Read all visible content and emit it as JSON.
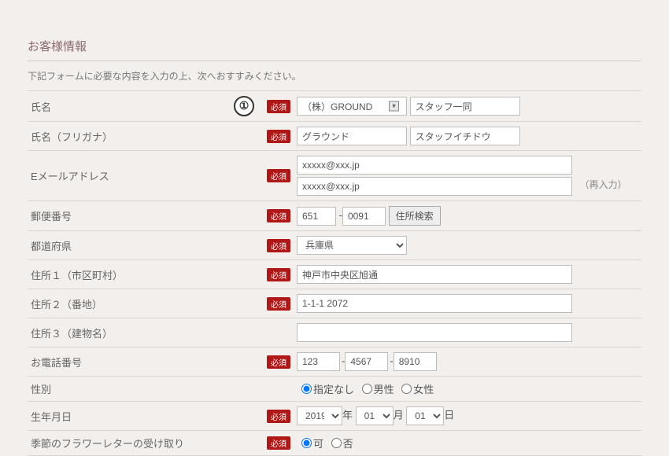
{
  "section_title": "お客様情報",
  "instruction": "下記フォームに必要な内容を入力の上、次へおすすみください。",
  "required_label": "必須",
  "fields": {
    "name": {
      "label": "氏名",
      "value1": "（株）GROUND",
      "value2": "スタッフ一同",
      "numbered": "①"
    },
    "furigana": {
      "label": "氏名（フリガナ）",
      "value1": "グラウンド",
      "value2": "スタッフイチドウ"
    },
    "email": {
      "label": "Eメールアドレス",
      "value1": "xxxxx@xxx.jp",
      "value2": "xxxxx@xxx.jp",
      "re_label": "（再入力）"
    },
    "postal": {
      "label": "郵便番号",
      "value1": "651",
      "value2": "0091",
      "search_btn": "住所検索"
    },
    "pref": {
      "label": "都道府県",
      "value": "兵庫県"
    },
    "addr1": {
      "label": "住所１（市区町村）",
      "value": "神戸市中央区旭通"
    },
    "addr2": {
      "label": "住所２（番地）",
      "value": "1-1-1 2072"
    },
    "addr3": {
      "label": "住所３（建物名）",
      "value": ""
    },
    "tel": {
      "label": "お電話番号",
      "v1": "123",
      "v2": "4567",
      "v3": "8910"
    },
    "gender": {
      "label": "性別",
      "opt_none": "指定なし",
      "opt_m": "男性",
      "opt_f": "女性"
    },
    "birth": {
      "label": "生年月日",
      "year": "2019",
      "month": "01",
      "day": "01",
      "y_l": "年",
      "m_l": "月",
      "d_l": "日"
    },
    "flower": {
      "label": "季節のフラワーレターの受け取り",
      "yes": "可",
      "no": "否"
    }
  }
}
